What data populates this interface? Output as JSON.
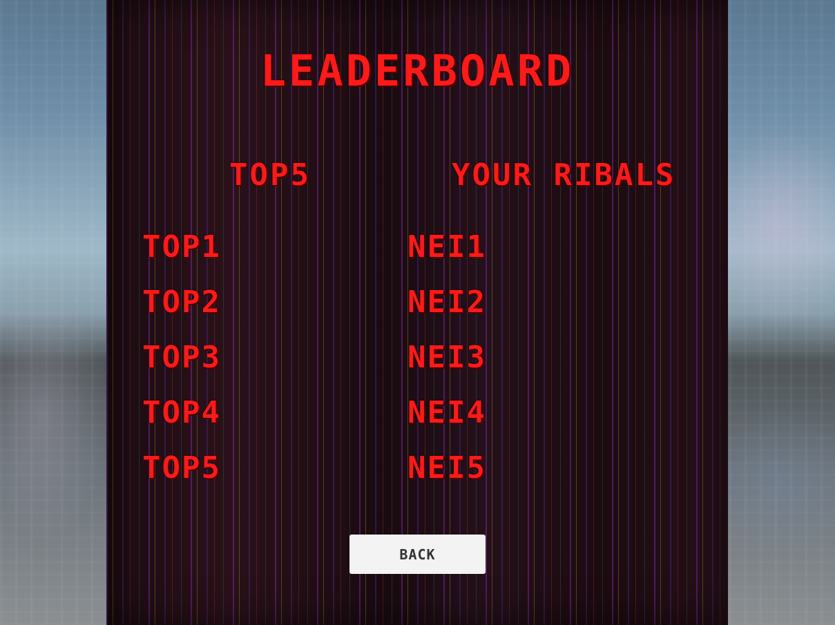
{
  "screen": {
    "title": "LEADERBOARD"
  },
  "columns": {
    "top_header": "TOP5",
    "rivals_header": "YOUR RIBALS"
  },
  "top_entries": [
    "TOP1",
    "TOP2",
    "TOP3",
    "TOP4",
    "TOP5"
  ],
  "rival_entries": [
    "NEI1",
    "NEI2",
    "NEI3",
    "NEI4",
    "NEI5"
  ],
  "buttons": {
    "back_label": "BACK"
  },
  "colors": {
    "accent_red": "#ff1a1a",
    "button_bg": "#f3f3f3",
    "button_text": "#333333"
  }
}
